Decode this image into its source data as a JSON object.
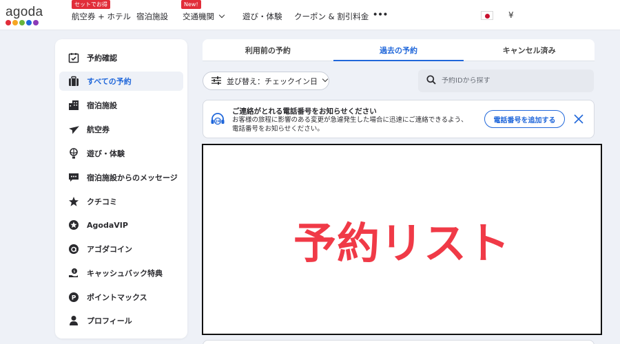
{
  "brand": {
    "name": "agoda",
    "dot_colors": [
      "#e12d39",
      "#f6a623",
      "#68b53c",
      "#2067da",
      "#8b3ab8"
    ]
  },
  "nav": {
    "items": [
      {
        "label": "航空券 + ホテル",
        "badge": "セットでお得"
      },
      {
        "label": "宿泊施設",
        "badge": ""
      },
      {
        "label": "交通機関",
        "badge": "New!"
      },
      {
        "label": "遊び・体験",
        "badge": ""
      },
      {
        "label": "クーポン & 割引料金",
        "badge": ""
      },
      {
        "label": "•••",
        "badge": ""
      }
    ],
    "currency": "¥"
  },
  "sidebar": {
    "items": [
      {
        "label": "予約確認",
        "icon": "calendar-check-icon"
      },
      {
        "label": "すべての予約",
        "icon": "suitcase-icon"
      },
      {
        "label": "宿泊施設",
        "icon": "building-icon"
      },
      {
        "label": "航空券",
        "icon": "airplane-icon"
      },
      {
        "label": "遊び・体験",
        "icon": "balloon-icon"
      },
      {
        "label": "宿泊施設からのメッセージ",
        "icon": "chat-icon"
      },
      {
        "label": "クチコミ",
        "icon": "star-icon"
      },
      {
        "label": "AgodaVIP",
        "icon": "vip-star-icon"
      },
      {
        "label": "アゴダコイン",
        "icon": "coin-icon"
      },
      {
        "label": "キャッシュバック特典",
        "icon": "cashback-icon"
      },
      {
        "label": "ポイントマックス",
        "icon": "points-icon"
      },
      {
        "label": "プロフィール",
        "icon": "person-icon"
      }
    ],
    "active_index": 1
  },
  "tabs": {
    "items": [
      "利用前の予約",
      "過去の予約",
      "キャンセル済み"
    ],
    "active_index": 1
  },
  "sort": {
    "label": "並び替え：チェックイン日"
  },
  "search": {
    "placeholder": "予約IDから探す"
  },
  "notice": {
    "title": "ご連絡がとれる電話番号をお知らせください",
    "body": "お客様の旅程に影響のある変更が急遽発生した場合に迅速にご連絡できるよう、電話番号をお知らせください。",
    "button": "電話番号を追加する",
    "icon_text": "24"
  },
  "list": {
    "overlay_text": "予約リスト"
  },
  "colors": {
    "accent": "#2067da",
    "overlay_text": "#f03a47",
    "badge": "#e12d39"
  }
}
